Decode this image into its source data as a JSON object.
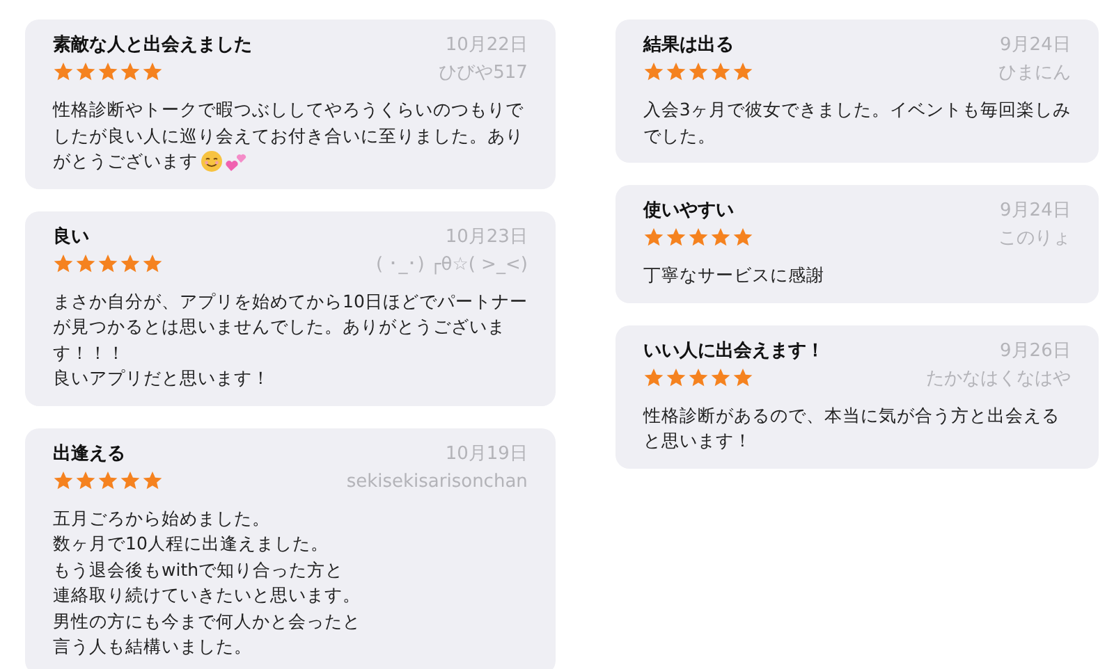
{
  "columns": [
    {
      "reviews": [
        {
          "title": "素敵な人と出会えました",
          "stars": 5,
          "date": "10月22日",
          "author": "ひびや517",
          "body": [
            "性格診断やトークで暇つぶししてやろうくらいのつもりで",
            "したが良い人に巡り会えてお付き合いに至りました。あり",
            "がとうございます"
          ],
          "kind": "with_emoji"
        },
        {
          "title": "良い",
          "stars": 5,
          "date": "10月23日",
          "author": "( ･_･) ┌θ☆( >_<)",
          "body": [
            "まさか自分が、アプリを始めてから10日ほどでパートナー",
            "が見つかるとは思いませんでした。ありがとうございま",
            "す！！！",
            "良いアプリだと思います！"
          ]
        },
        {
          "title": "出逢える",
          "stars": 5,
          "date": "10月19日",
          "author": "sekisekisarisonchan",
          "body": [
            "五月ごろから始めました。",
            "数ヶ月で10人程に出逢えました。",
            "もう退会後もwithで知り合った方と",
            "連絡取り続けていきたいと思います。",
            "男性の方にも今まで何人かと会ったと",
            "言う人も結構いました。"
          ]
        }
      ]
    },
    {
      "reviews": [
        {
          "title": "結果は出る",
          "stars": 5,
          "date": "9月24日",
          "author": "ひまにん",
          "body": [
            "入会3ヶ月で彼女できました。イベントも毎回楽しみ",
            "でした。"
          ]
        },
        {
          "title": "使いやすい",
          "stars": 5,
          "date": "9月24日",
          "author": "このりょ",
          "body": [
            "丁寧なサービスに感謝"
          ]
        },
        {
          "title": "いい人に出会えます！",
          "stars": 5,
          "date": "9月26日",
          "author": "たかなはくなはや",
          "body": [
            "性格診断があるので、本当に気が合う方と出会える",
            "と思います！"
          ]
        }
      ]
    }
  ]
}
